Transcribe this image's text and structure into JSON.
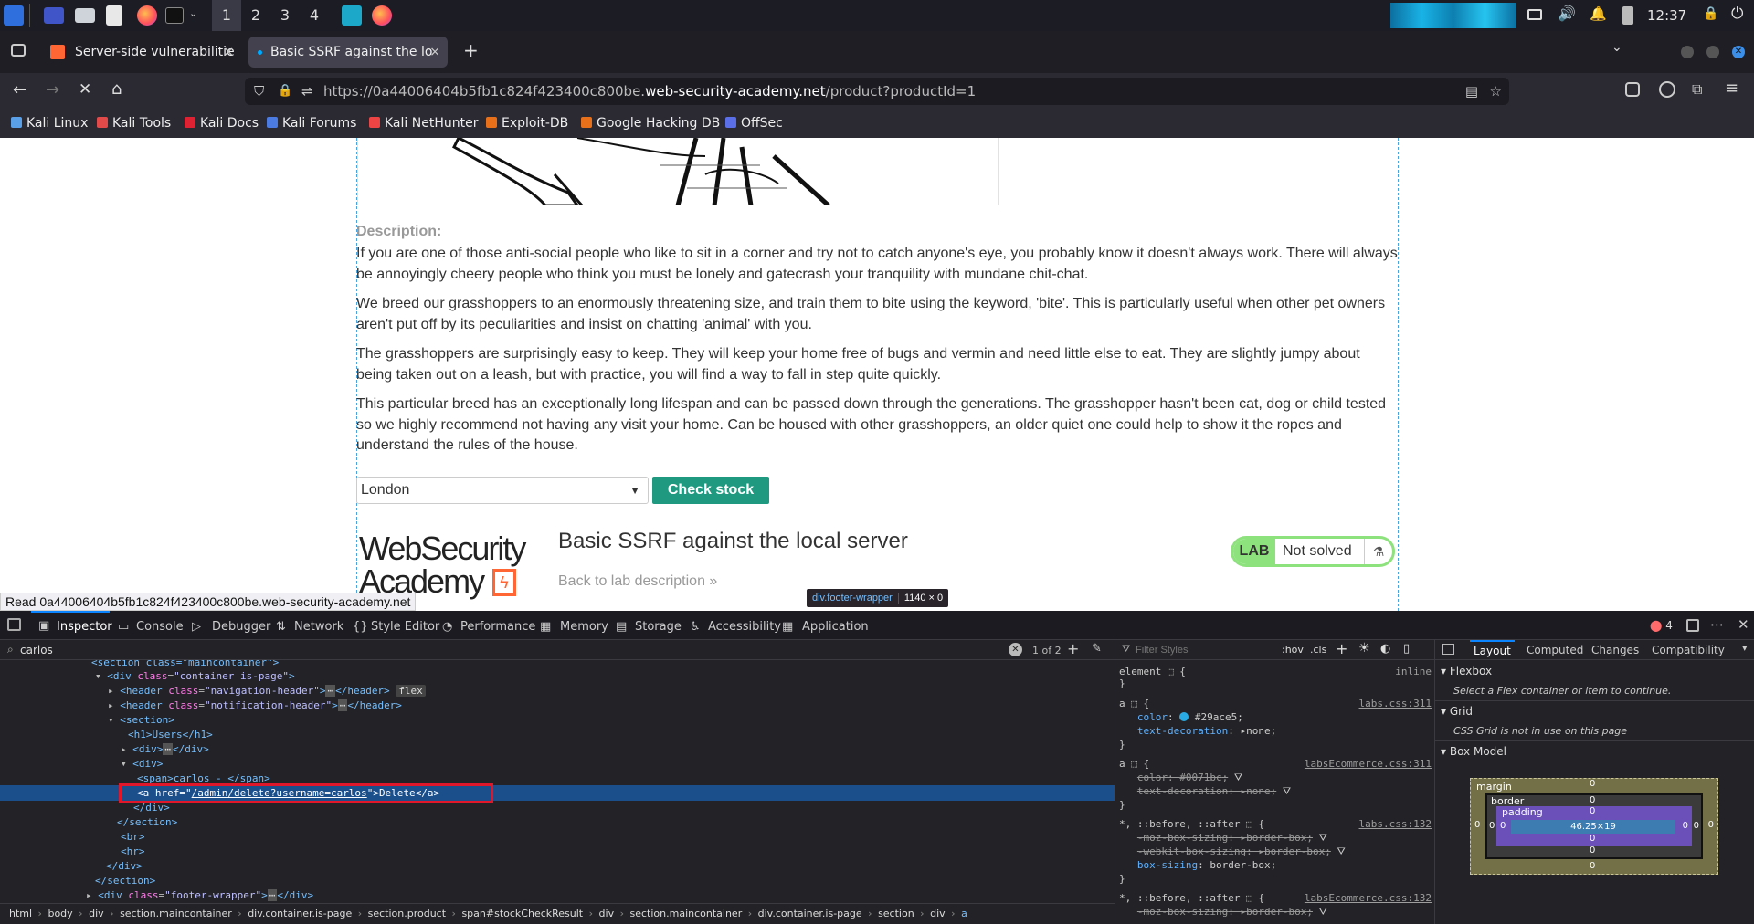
{
  "taskbar": {
    "workspaces": [
      "1",
      "2",
      "3",
      "4"
    ],
    "clock": "12:37"
  },
  "tabs": [
    {
      "label": "Server-side vulnerabilitie",
      "close": "×"
    },
    {
      "label": "Basic SSRF against the lo",
      "close": "×"
    }
  ],
  "url": {
    "prefix": "https://0a44006404b5fb1c824f423400c800be.",
    "domain": "web-security-academy.net",
    "path": "/product?productId=1"
  },
  "bookmarks": [
    "Kali Linux",
    "Kali Tools",
    "Kali Docs",
    "Kali Forums",
    "Kali NetHunter",
    "Exploit-DB",
    "Google Hacking DB",
    "OffSec"
  ],
  "product": {
    "description_label": "Description:",
    "paragraphs": [
      "If you are one of those anti-social people who like to sit in a corner and try not to catch anyone's eye, you probably know it doesn't always work. There will always be annoyingly cheery people who think you must be lonely and gatecrash your tranquility with mundane chit-chat.",
      "We breed our grasshoppers to an enormously threatening size, and train them to bite using the keyword, 'bite'. This is particularly useful when other pet owners aren't put off by its peculiarities and insist on chatting 'animal' with you.",
      "The grasshoppers are surprisingly easy to keep. They will keep your home free of bugs and vermin and need little else to eat. They are slightly jumpy about being taken out on a leash, but with practice, you will find a way to fall in step quite quickly.",
      "This particular breed has an exceptionally long lifespan and can be passed down through the generations. The grasshopper hasn't been cat, dog or child tested so we highly recommend not having any visit your home. Can be housed with other grasshoppers, an older quiet one could help to show it the ropes and understand the rules of the house."
    ],
    "store_select": "London",
    "check_stock": "Check stock"
  },
  "lab": {
    "logo_line1": "WebSecurity",
    "logo_line2": "Academy",
    "title": "Basic SSRF against the local server",
    "back_link": "Back to lab description",
    "badge": "LAB",
    "status": "Not solved"
  },
  "overlay": {
    "tooltip_name": "div.footer-wrapper",
    "tooltip_size": "1140 × 0",
    "status_bar": "Read 0a44006404b5fb1c824f423400c800be.web-security-academy.net"
  },
  "devtools": {
    "tabs": [
      "Inspector",
      "Console",
      "Debugger",
      "Network",
      "Style Editor",
      "Performance",
      "Memory",
      "Storage",
      "Accessibility",
      "Application"
    ],
    "error_count": "4",
    "search_value": "carlos",
    "search_count": "1 of 2",
    "filter_placeholder": "Filter Styles",
    "hov": ":hov",
    "cls": ".cls",
    "right_tabs": [
      "Layout",
      "Computed",
      "Changes",
      "Compatibility"
    ],
    "flexbox_title": "Flexbox",
    "flexbox_msg": "Select a Flex container or item to continue.",
    "grid_title": "Grid",
    "grid_msg": "CSS Grid is not in use on this page",
    "boxmodel_title": "Box Model",
    "box": {
      "margin": "margin",
      "border": "border",
      "padding": "padding",
      "content": "46.25×19",
      "zero": "0"
    },
    "breadcrumbs": [
      "html",
      "body",
      "div",
      "section.maincontainer",
      "div.container.is-page",
      "section.product",
      "span#stockCheckResult",
      "div",
      "section.maincontainer",
      "div.container.is-page",
      "section",
      "div",
      "a"
    ],
    "rules": {
      "r0_sel": "element",
      "r0_src": "inline",
      "r1_sel": "a",
      "r1_src": "labs.css:311",
      "r1_p1": "color",
      "r1_v1": "#29ace5",
      "r1_p2": "text-decoration",
      "r1_v2": "none",
      "r2_src": "labsEcommerce.css:311",
      "r2_v1": "#0071bc",
      "r3_sel": "*, ::before, ::after",
      "r3_src": "labs.css:132",
      "r3_p1": "-moz-box-sizing",
      "r3_p2": "-webkit-box-sizing",
      "r3_p3": "box-sizing",
      "r3_v": "border-box",
      "r4_src": "labsEcommerce.css:132"
    }
  },
  "html_tree": {
    "l0": "<section class=\"maincontainer\">",
    "l1_tag": "div",
    "l1_cls": "container is-page",
    "l2_cls": "navigation-header",
    "flex": "flex",
    "l3_cls": "notification-header",
    "l4": "section",
    "l5": "<h1>Users</h1>",
    "l6": "div",
    "l7": "div",
    "l8": "<span>carlos - </span>",
    "l9_href": "/admin/delete?username=carlos",
    "l9_text": "Delete",
    "l10": "</div>",
    "l11": "</section>",
    "l12": "<br>",
    "l13": "<hr>",
    "l14": "</div>",
    "l15": "</section>",
    "l16_cls": "footer-wrapper"
  }
}
